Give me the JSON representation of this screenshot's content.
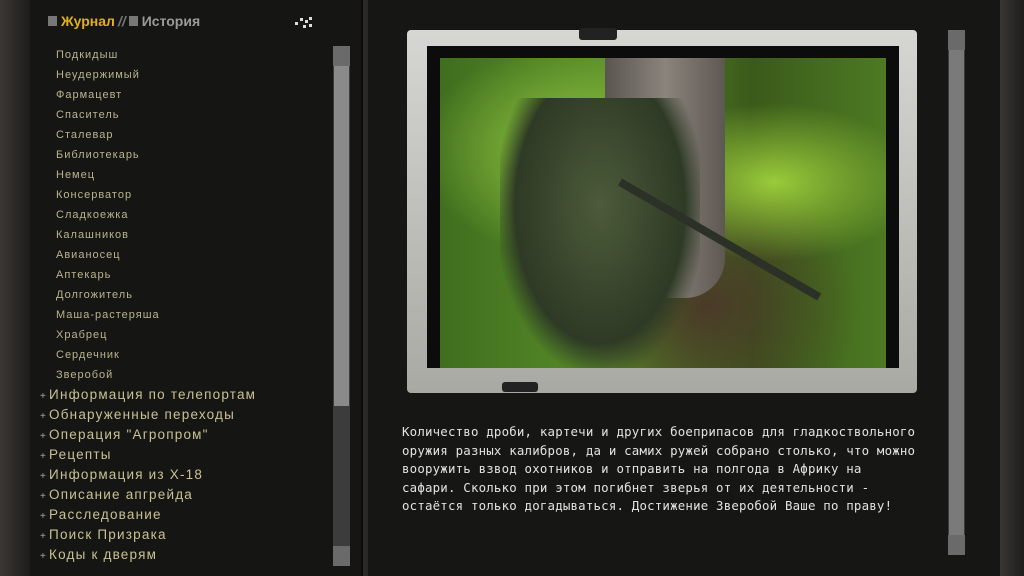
{
  "tabs": {
    "journal": "Журнал",
    "separator": "//",
    "history": "История"
  },
  "achievements": [
    "Подкидыш",
    "Неудержимый",
    "Фармацевт",
    "Спаситель",
    "Сталевар",
    "Библиотекарь",
    "Немец",
    "Консерватор",
    "Сладкоежка",
    "Калашников",
    "Авианосец",
    "Аптекарь",
    "Долгожитель",
    "Маша-растеряша",
    "Храбрец",
    "Сердечник",
    "Зверобой"
  ],
  "groups": [
    "Информация по телепортам",
    "Обнаруженные переходы",
    "Операция \"Агропром\"",
    "Рецепты",
    "Информация из X-18",
    "Описание апгрейда",
    "Расследование",
    "Поиск Призрака",
    "Коды к дверям"
  ],
  "group_prefix": "+",
  "description": "Количество дроби, картечи и других боеприпасов для гладкоствольного оружия разных калибров, да и самих ружей собрано столько, что можно вооружить взвод охотников и отправить на полгода в Африку на сафари. Сколько при этом погибнет зверья от их деятельности - остаётся только догадываться. Достижение Зверобой Ваше по праву!",
  "colors": {
    "active_tab": "#e0b020",
    "list_text": "#b9b48f",
    "body_text": "#e2e2e2"
  }
}
